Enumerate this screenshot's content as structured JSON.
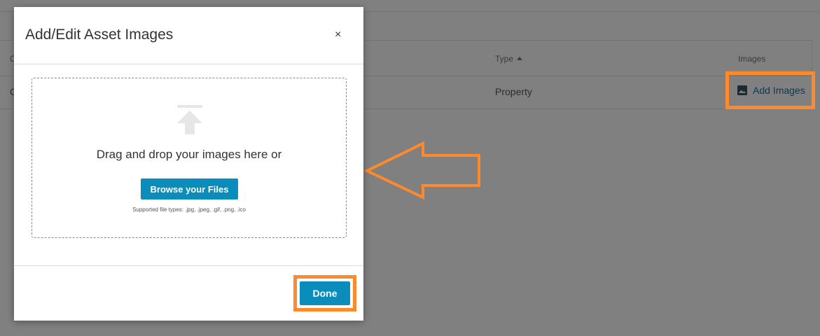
{
  "background": {
    "table": {
      "headers": {
        "first_col_partial": "C",
        "type": "Type",
        "images": "Images"
      },
      "rows": [
        {
          "first_col_partial": "C",
          "type": "Property",
          "images_action": "Add Images"
        }
      ]
    }
  },
  "modal": {
    "title": "Add/Edit Asset Images",
    "close_label": "×",
    "dropzone": {
      "prompt": "Drag and drop your images here or",
      "browse_label": "Browse your Files",
      "supported_types": "Supported file types: .jpg, .jpeg, .gif, .png, .ico"
    },
    "done_label": "Done"
  },
  "colors": {
    "overlay": "#808080",
    "modal_bg": "#ffffff",
    "accent_button": "#0b8dbc",
    "annotation_highlight": "#ff8a2b",
    "link_text": "#0b3a52"
  },
  "icons": {
    "upload": "upload-icon",
    "image": "image-icon",
    "close": "close-icon",
    "sort": "sort-ascending-icon",
    "annotation_arrow": "arrow-left-annotation"
  }
}
